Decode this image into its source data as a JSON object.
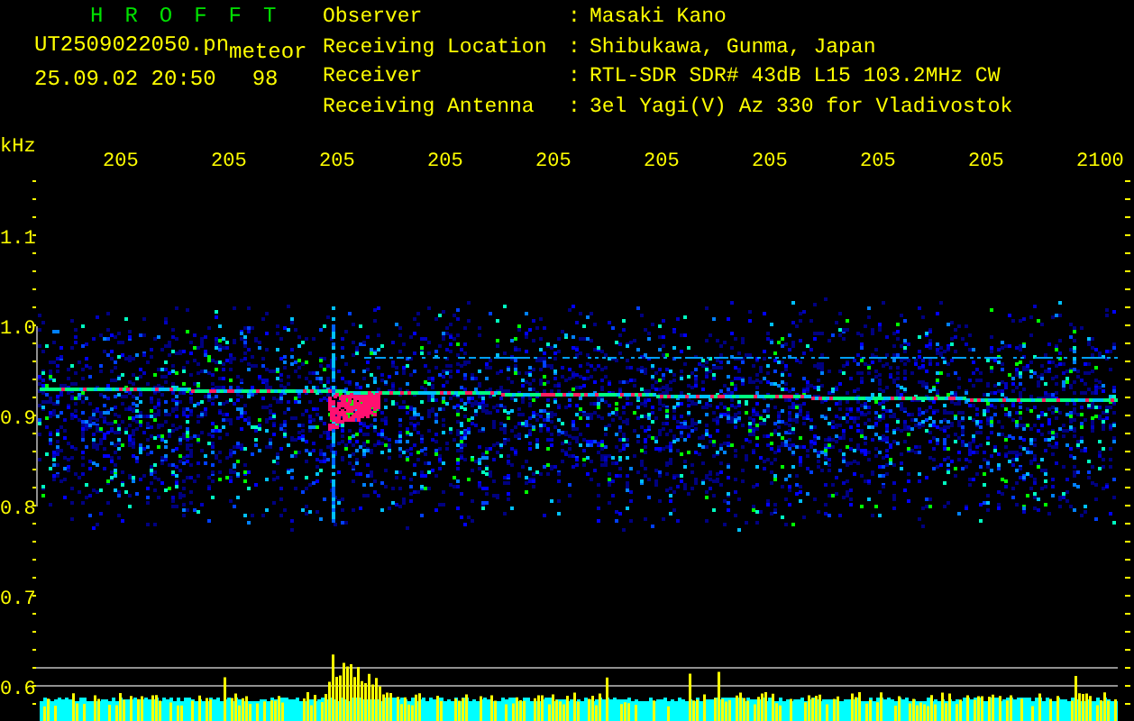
{
  "header": {
    "title": "H R O F F T",
    "filename": "UT2509022050.pn",
    "tag": "meteor",
    "timestamp": "25.09.02 20:50",
    "count": "98"
  },
  "station_info": [
    {
      "label": "Observer",
      "separator": ":",
      "value": "Masaki Kano"
    },
    {
      "label": "Receiving Location",
      "separator": ":",
      "value": "Shibukawa, Gunma, Japan"
    },
    {
      "label": "Receiver",
      "separator": ":",
      "value": "RTL-SDR SDR# 43dB L15 103.2MHz CW"
    },
    {
      "label": "Receiving Antenna",
      "separator": ":",
      "value": "3el Yagi(V) Az 330 for Vladivostok"
    }
  ],
  "x_axis": {
    "unit": "kHz",
    "labels": [
      "205",
      "205",
      "205",
      "205",
      "205",
      "205",
      "205",
      "205",
      "205",
      "2100"
    ]
  },
  "y_axis": {
    "labels": [
      "1.1",
      "1.0",
      "0.9",
      "0.8",
      "0.7",
      "0.6"
    ]
  }
}
